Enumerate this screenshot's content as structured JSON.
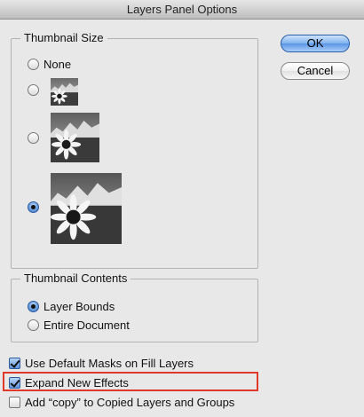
{
  "window": {
    "title": "Layers Panel Options"
  },
  "thumbnail_size": {
    "legend": "Thumbnail Size",
    "options": [
      "None",
      "",
      "",
      ""
    ],
    "selected_index": 3
  },
  "thumbnail_contents": {
    "legend": "Thumbnail Contents",
    "options": [
      "Layer Bounds",
      "Entire Document"
    ],
    "selected_index": 0
  },
  "checkboxes": [
    {
      "label": "Use Default Masks on Fill Layers",
      "checked": true
    },
    {
      "label": "Expand New Effects",
      "checked": true
    },
    {
      "label": "Add “copy” to Copied Layers and Groups",
      "checked": false
    }
  ],
  "buttons": {
    "ok_label": "OK",
    "cancel_label": "Cancel"
  },
  "colors": {
    "highlight": "#e0392b",
    "default_button": "#5a96e6"
  },
  "icons": {
    "thumbnail_image": "sunflower-mountain-thumbnail"
  }
}
